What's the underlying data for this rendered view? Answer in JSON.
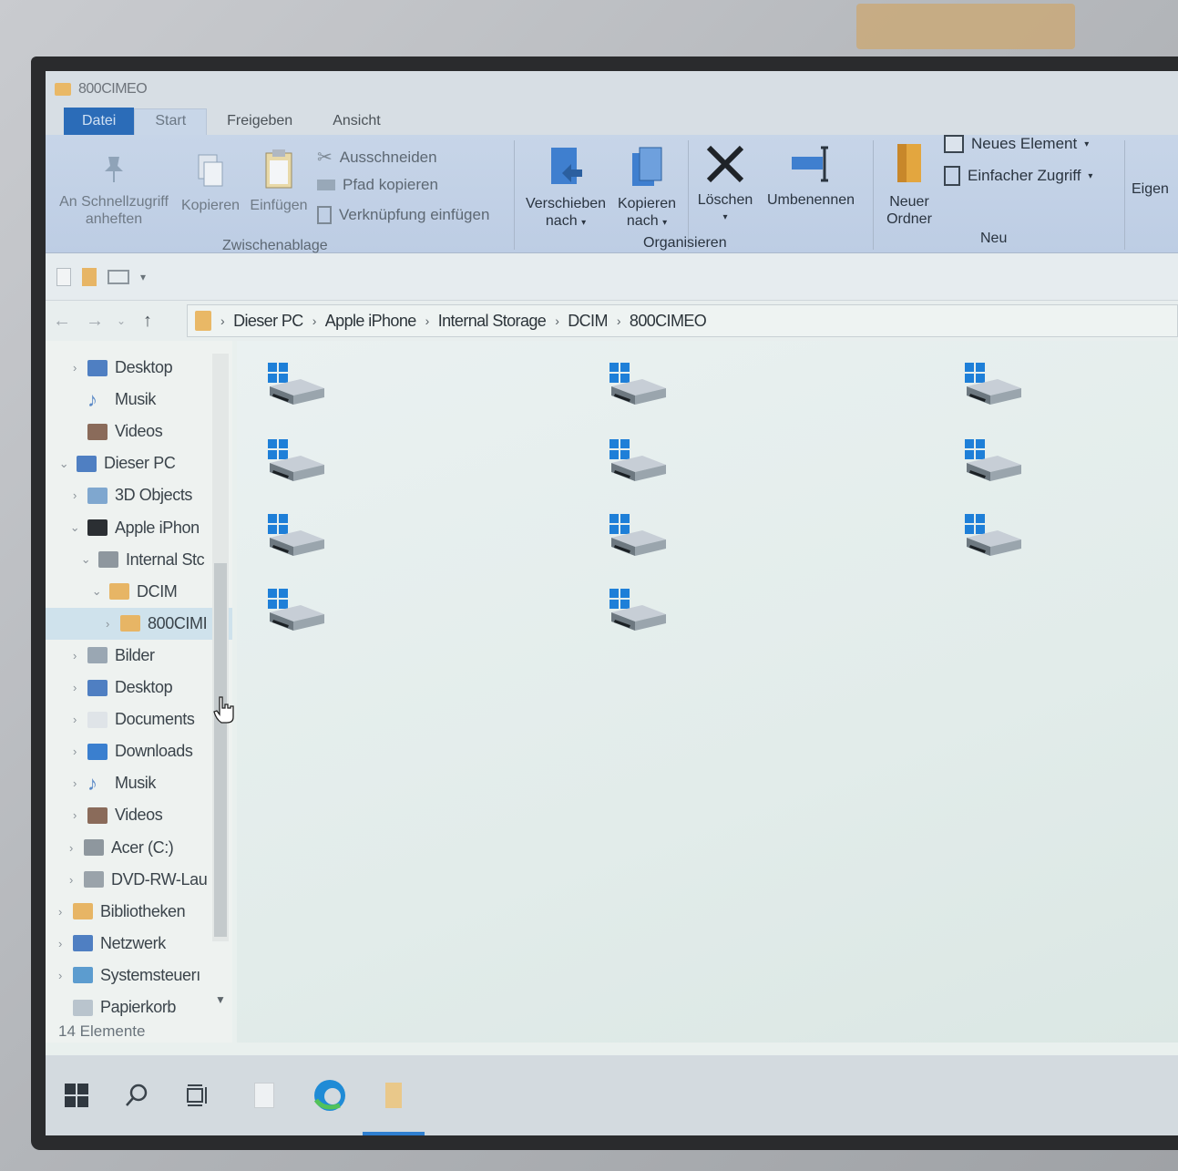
{
  "window": {
    "title": "800CIMEO"
  },
  "ribbon_tabs": [
    {
      "label": "Datei"
    },
    {
      "label": "Start"
    },
    {
      "label": "Freigeben"
    },
    {
      "label": "Ansicht"
    }
  ],
  "ribbon": {
    "pin_label_1": "An Schnellzugriff",
    "pin_label_2": "anheften",
    "copy_label": "Kopieren",
    "paste_label": "Einfügen",
    "cut_label": "Ausschneiden",
    "copy_path_label": "Pfad kopieren",
    "paste_shortcut_label": "Verknüpfung einfügen",
    "clipboard_group": "Zwischenablage",
    "move_to_label_1": "Verschieben",
    "move_to_label_2": "nach",
    "copy_to_label_1": "Kopieren",
    "copy_to_label_2": "nach",
    "delete_label": "Löschen",
    "rename_label": "Umbenennen",
    "organize_group": "Organisieren",
    "new_folder_label_1": "Neuer",
    "new_folder_label_2": "Ordner",
    "new_item_label": "Neues Element",
    "easy_access_label": "Einfacher Zugriff",
    "new_group": "Neu",
    "properties_label": "Eigen"
  },
  "breadcrumb": [
    "Dieser PC",
    "Apple iPhone",
    "Internal Storage",
    "DCIM",
    "800CIMEO"
  ],
  "nav_tree": [
    {
      "label": "Desktop",
      "chevron": "›",
      "icon": "desktop-icon"
    },
    {
      "label": "Musik",
      "chevron": "",
      "icon": "music-icon"
    },
    {
      "label": "Videos",
      "chevron": "",
      "icon": "videos-icon"
    },
    {
      "label": "Dieser PC",
      "chevron": "⌄",
      "icon": "pc-icon"
    },
    {
      "label": "3D Objects",
      "chevron": "›",
      "icon": "3d-objects-icon"
    },
    {
      "label": "Apple iPhon",
      "chevron": "⌄",
      "icon": "phone-icon"
    },
    {
      "label": "Internal Stc",
      "chevron": "⌄",
      "icon": "storage-icon"
    },
    {
      "label": "DCIM",
      "chevron": "⌄",
      "icon": "folder-icon"
    },
    {
      "label": "800CIMI",
      "chevron": "›",
      "icon": "folder-icon"
    },
    {
      "label": "Bilder",
      "chevron": "›",
      "icon": "pictures-icon"
    },
    {
      "label": "Desktop",
      "chevron": "›",
      "icon": "desktop-icon"
    },
    {
      "label": "Documents",
      "chevron": "›",
      "icon": "documents-icon"
    },
    {
      "label": "Downloads",
      "chevron": "›",
      "icon": "downloads-icon"
    },
    {
      "label": "Musik",
      "chevron": "›",
      "icon": "music-icon"
    },
    {
      "label": "Videos",
      "chevron": "›",
      "icon": "videos-icon"
    },
    {
      "label": "Acer (C:)",
      "chevron": "›",
      "icon": "drive-icon"
    },
    {
      "label": "DVD-RW-Lau",
      "chevron": "›",
      "icon": "dvd-icon"
    },
    {
      "label": "Bibliotheken",
      "chevron": "›",
      "icon": "libraries-icon"
    },
    {
      "label": "Netzwerk",
      "chevron": "›",
      "icon": "network-icon"
    },
    {
      "label": "Systemsteuerı",
      "chevron": "›",
      "icon": "control-panel-icon"
    },
    {
      "label": "Papierkorb",
      "chevron": "",
      "icon": "recycle-bin-icon"
    }
  ],
  "status": {
    "item_count": "14 Elemente"
  },
  "colors": {
    "accent": "#2b6cb8",
    "ribbon_bg": "#c7d5e8",
    "selection": "#cfe2ec"
  }
}
